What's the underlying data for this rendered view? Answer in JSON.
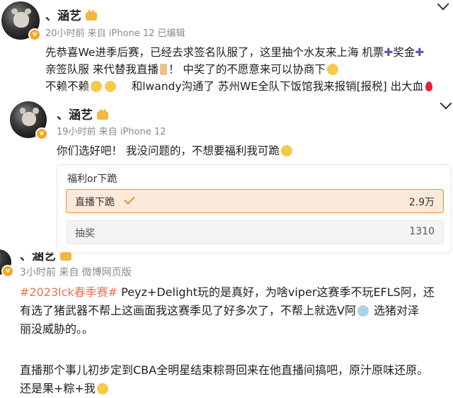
{
  "post1": {
    "author": "、涵艺",
    "meta": "20小时前 来自 iPhone 12 已编辑",
    "line1a": "先恭喜We进季后赛，已经去求签名队服了，这里抽个水友来上海 机票",
    "plus1": "✚",
    "line1b": "奖金",
    "plus2": "✚",
    "line2": "亲签队服 来代替我直播",
    "line2b": "！ 中奖了的不愿意来可以协商下",
    "line3a": "不赖不赖",
    "line3b": "和lwandy沟通了 苏州WE全队下饭馆我来报销[报税] 出大血"
  },
  "post2": {
    "author": "、涵艺",
    "meta": "19小时前 来自 iPhone 12",
    "text": "你们选好吧！ 我没问题的，不想要福利我可跪"
  },
  "poll": {
    "question": "福利or下跪",
    "options": [
      {
        "label": "直播下跪",
        "count": "2.9万",
        "selected": true
      },
      {
        "label": "抽奖",
        "count": "1310",
        "selected": false
      }
    ]
  },
  "post3": {
    "author": "、涵艺",
    "meta": "3小时前 来自 微博网页版",
    "tag": "#2023lck春季赛#",
    "line1": " Peyz+Delight玩的是真好，为啥viper这赛季不玩EFLS阿，还",
    "line2": "有选了猪武器不帮上这画面我这赛季见了好多次了，不帮上就选V阿",
    "line2b": " 选猪对泽",
    "line3": "丽没威胁的。。",
    "line4": "直播那个事儿初步定到CBA全明星结束粽哥回来在他直播间搞吧，原汁原味还原。",
    "line5": "还是果+粽+我"
  }
}
